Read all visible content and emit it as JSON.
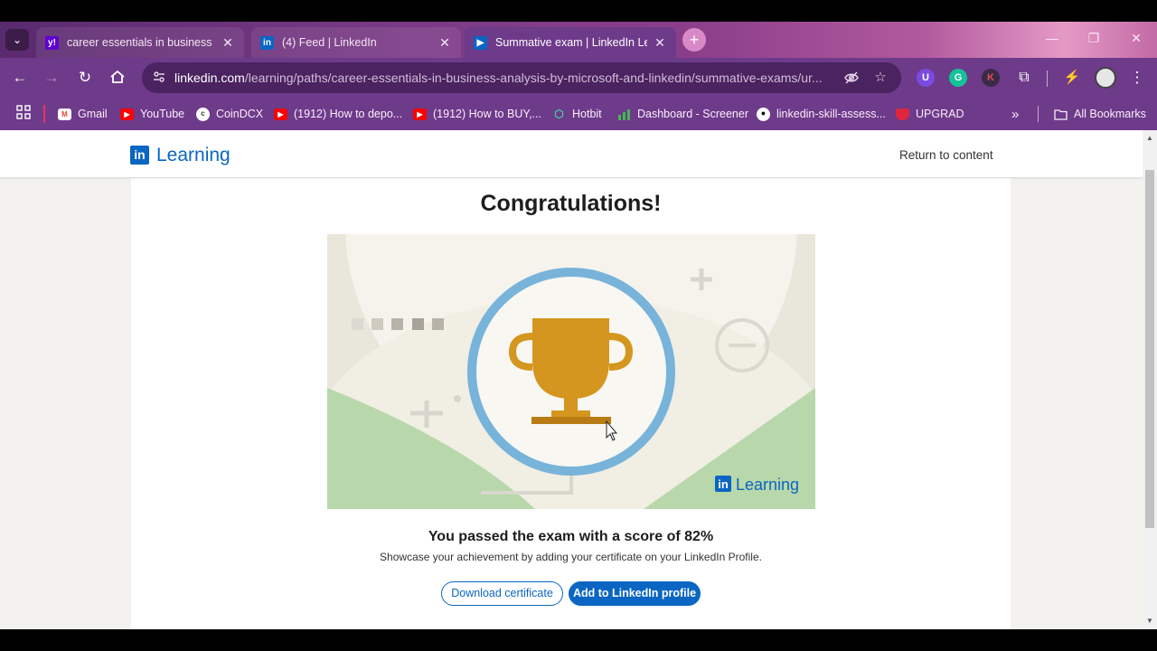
{
  "browser": {
    "tabs": [
      {
        "title": "career essentials in business an",
        "favicon": "yahoo-icon",
        "active": false
      },
      {
        "title": "(4) Feed | LinkedIn",
        "favicon": "linkedin-icon",
        "active": false
      },
      {
        "title": "Summative exam | LinkedIn Lea",
        "favicon": "linkedin-learning-icon",
        "active": true
      }
    ],
    "new_tab": "+",
    "url_host": "linkedin.com",
    "url_path": "/learning/paths/career-essentials-in-business-analysis-by-microsoft-and-linkedin/summative-exams/ur...",
    "bookmarks": [
      {
        "label": "Gmail",
        "icon": "gmail-icon"
      },
      {
        "label": "YouTube",
        "icon": "youtube-icon"
      },
      {
        "label": "CoinDCX",
        "icon": "coindcx-icon"
      },
      {
        "label": "(1912) How to depo...",
        "icon": "youtube-icon"
      },
      {
        "label": "(1912) How to BUY,...",
        "icon": "youtube-icon"
      },
      {
        "label": "Hotbit",
        "icon": "hotbit-icon"
      },
      {
        "label": "Dashboard - Screener",
        "icon": "chart-bars-icon"
      },
      {
        "label": "linkedin-skill-assess...",
        "icon": "github-icon"
      },
      {
        "label": "UPGRAD",
        "icon": "upgrad-icon"
      }
    ],
    "all_bookmarks": "All Bookmarks",
    "more_bookmarks": "»"
  },
  "header": {
    "logo_mark": "in",
    "logo_text": "Learning",
    "return_link": "Return to content"
  },
  "result": {
    "heading": "Congratulations!",
    "score_text": "You passed the exam with a score of 82%",
    "score_percent": 82,
    "showcase_text": "Showcase your achievement by adding your certificate on your LinkedIn Profile.",
    "download_button": "Download certificate",
    "add_profile_button": "Add to LinkedIn profile",
    "badge_logo_mark": "in",
    "badge_logo_text": "Learning"
  },
  "colors": {
    "linkedin_blue": "#0a66c2",
    "trophy_gold": "#d4961e",
    "ring_blue": "#78b3d9",
    "illus_green": "#b8d8ab"
  }
}
